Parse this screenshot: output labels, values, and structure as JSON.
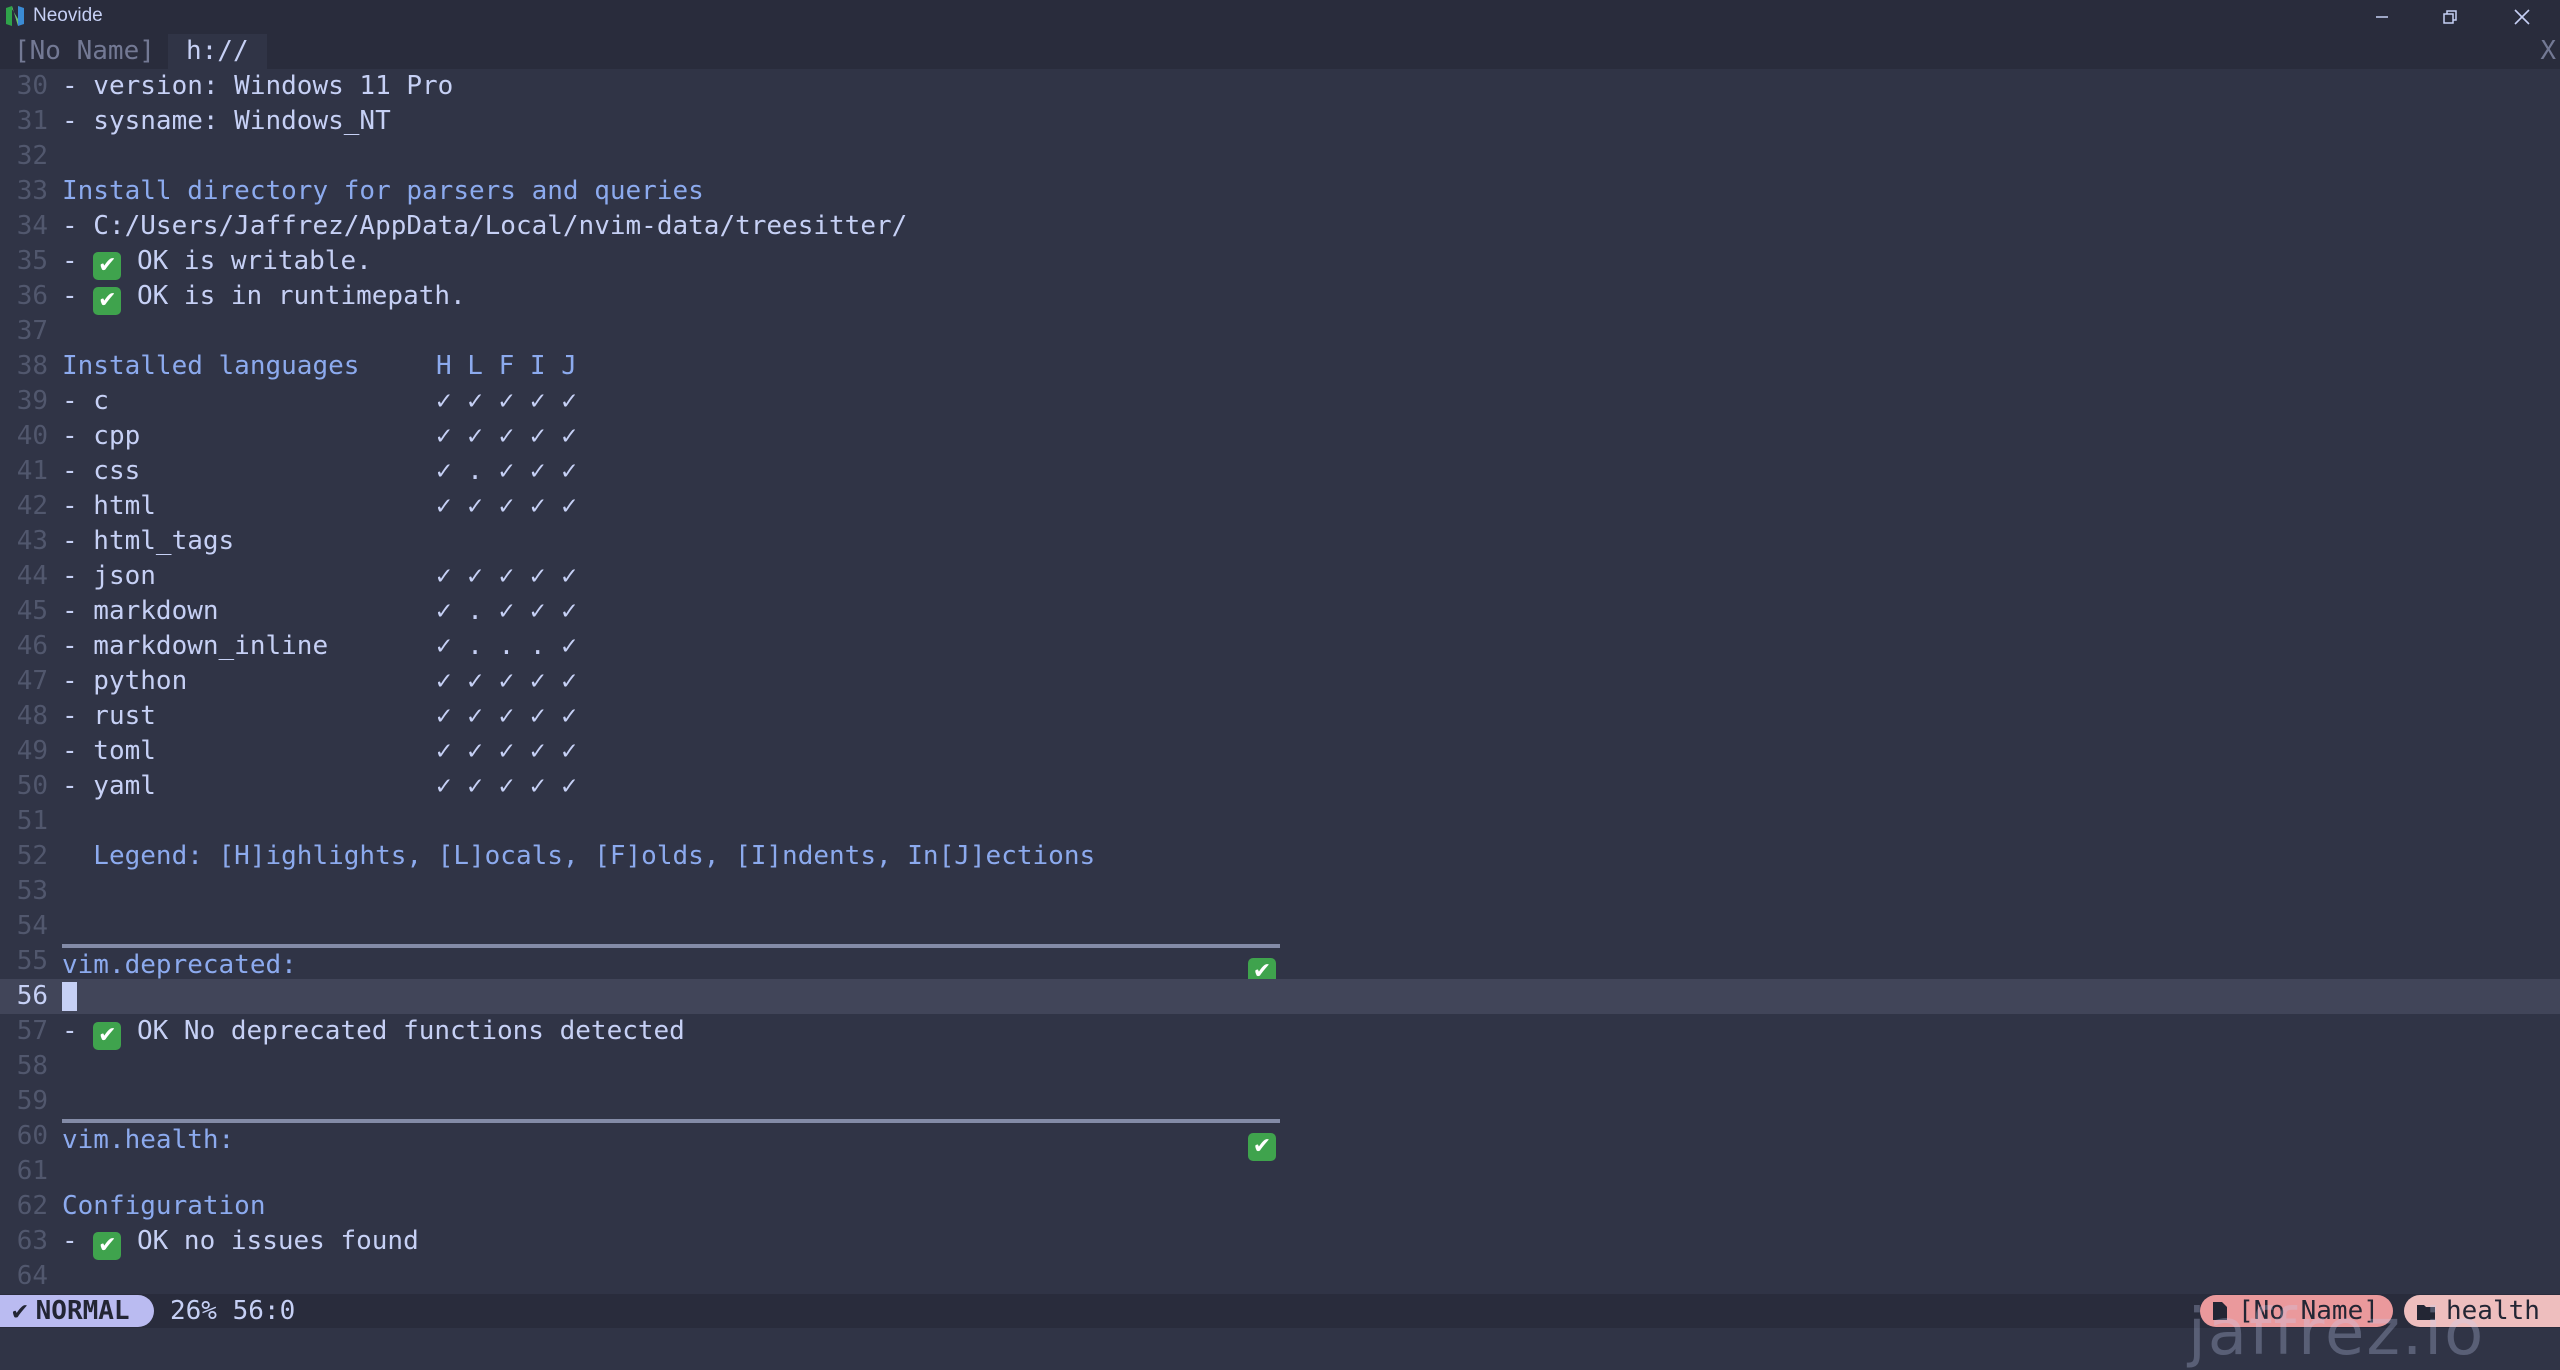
{
  "window": {
    "title": "Neovide",
    "buttons": {
      "minimize": "minimize-icon",
      "maximize": "restore-icon",
      "close": "close-icon"
    }
  },
  "tabline": {
    "tabs": [
      {
        "label": "[No Name]"
      },
      {
        "label": "h://"
      }
    ],
    "close_label": "X"
  },
  "buffer": {
    "lines": {
      "l30": {
        "num": "30",
        "text": "- version: Windows 11 Pro"
      },
      "l31": {
        "num": "31",
        "text": "- sysname: Windows_NT"
      },
      "l32": {
        "num": "32",
        "text": ""
      },
      "l33": {
        "num": "33",
        "text": "Install directory for parsers and queries"
      },
      "l34": {
        "num": "34",
        "text": "- C:/Users/Jaffrez/AppData/Local/nvim-data/treesitter/"
      },
      "l35": {
        "num": "35",
        "prefix": "- ",
        "text": " OK is writable."
      },
      "l36": {
        "num": "36",
        "prefix": "- ",
        "text": " OK is in runtimepath."
      },
      "l37": {
        "num": "37",
        "text": ""
      },
      "l38": {
        "num": "38",
        "text": "Installed languages",
        "flags": "H L F I J"
      },
      "l51": {
        "num": "51",
        "text": ""
      },
      "l52": {
        "num": "52",
        "text": "  Legend: [H]ighlights, [L]ocals, [F]olds, [I]ndents, In[J]ections"
      },
      "l53": {
        "num": "53",
        "text": ""
      },
      "l54": {
        "num": "54",
        "text": ""
      },
      "l55": {
        "num": "55",
        "text": "vim.deprecated:"
      },
      "l56": {
        "num": "56",
        "text": ""
      },
      "l57": {
        "num": "57",
        "prefix": "- ",
        "text": " OK No deprecated functions detected"
      },
      "l58": {
        "num": "58",
        "text": ""
      },
      "l59": {
        "num": "59",
        "text": ""
      },
      "l60": {
        "num": "60",
        "text": "vim.health:"
      },
      "l61": {
        "num": "61",
        "text": ""
      },
      "l62": {
        "num": "62",
        "text": "Configuration"
      },
      "l63": {
        "num": "63",
        "prefix": "- ",
        "text": " OK no issues found"
      },
      "l64": {
        "num": "64",
        "text": ""
      }
    },
    "languages": [
      {
        "num": "39",
        "name": "- c",
        "flags": "✓ ✓ ✓ ✓ ✓"
      },
      {
        "num": "40",
        "name": "- cpp",
        "flags": "✓ ✓ ✓ ✓ ✓"
      },
      {
        "num": "41",
        "name": "- css",
        "flags": "✓ . ✓ ✓ ✓"
      },
      {
        "num": "42",
        "name": "- html",
        "flags": "✓ ✓ ✓ ✓ ✓"
      },
      {
        "num": "43",
        "name": "- html_tags",
        "flags": ""
      },
      {
        "num": "44",
        "name": "- json",
        "flags": "✓ ✓ ✓ ✓ ✓"
      },
      {
        "num": "45",
        "name": "- markdown",
        "flags": "✓ . ✓ ✓ ✓"
      },
      {
        "num": "46",
        "name": "- markdown_inline",
        "flags": "✓ . . . ✓"
      },
      {
        "num": "47",
        "name": "- python",
        "flags": "✓ ✓ ✓ ✓ ✓"
      },
      {
        "num": "48",
        "name": "- rust",
        "flags": "✓ ✓ ✓ ✓ ✓"
      },
      {
        "num": "49",
        "name": "- toml",
        "flags": "✓ ✓ ✓ ✓ ✓"
      },
      {
        "num": "50",
        "name": "- yaml",
        "flags": "✓ ✓ ✓ ✓ ✓"
      }
    ],
    "ok_glyph": "✔"
  },
  "statusline": {
    "mode": "NORMAL",
    "mode_icon": "vim-icon",
    "position": "26% 56:0",
    "file": "[No Name]",
    "file_icon": "file-icon",
    "directory": "health",
    "directory_icon": "folder-icon"
  },
  "watermark": "jaffrez.io",
  "colors": {
    "background": "#303446",
    "foreground": "#c6d0f5",
    "header": "#8caaee",
    "ok_badge": "#3fa34d",
    "mode_bg": "#babbf1",
    "file_pill": "#ea999c",
    "dir_pill": "#eebebe"
  }
}
